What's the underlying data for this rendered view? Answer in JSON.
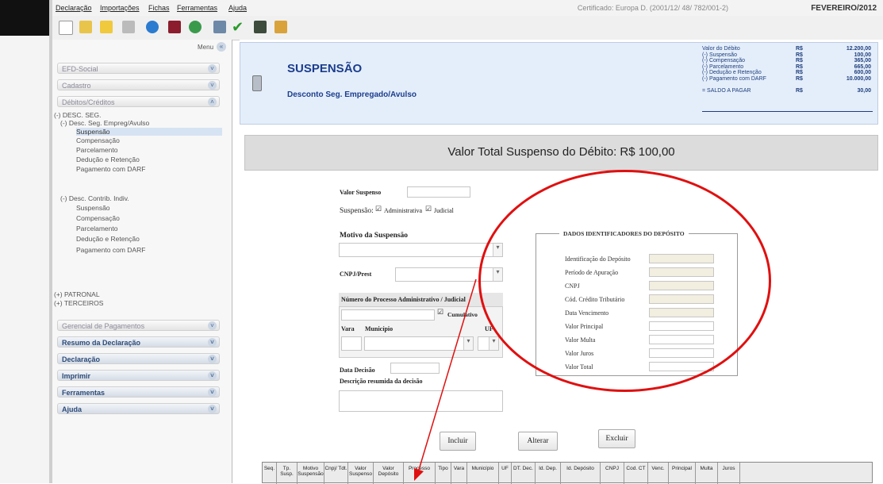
{
  "menu": [
    "Declaração",
    "Importações",
    "Fichas",
    "Ferramentas",
    "Ajuda"
  ],
  "toolbar": {
    "icons": [
      "new-file-icon",
      "open-folder-icon",
      "folder-icon",
      "trash-icon",
      "globe-icon",
      "save-icon",
      "cd-icon",
      "print-icon",
      "check-icon",
      "document-icon",
      "book-icon"
    ],
    "certificate": "Certificado: Europa D. (2001/12/ 48/ 782/001-2)",
    "period": "FEVEREIRO/2012"
  },
  "sidebar": {
    "menu_label": "Menu",
    "sections_top": [
      "EFD-Social",
      "Cadastro",
      "Débitos/Créditos"
    ],
    "tree": {
      "root": "(-) DESC. SEG.",
      "group1": "(-) Desc. Seg. Empreg/Avulso",
      "group1_items": [
        "Suspensão",
        "Compensação",
        "Parcelamento",
        "Dedução e Retenção",
        "Pagamento com DARF"
      ],
      "group1_selected": "Suspensão",
      "group2": "(-) Desc. Contrib. Indiv.",
      "group2_items": [
        "Suspensão",
        "Compensação",
        "Parcelamento",
        "Dedução e Retenção",
        "Pagamento com DARF"
      ],
      "extra": [
        "(+) PATRONAL",
        "(+) TERCEIROS"
      ]
    },
    "sections_bottom": [
      "Gerencial de Pagamentos",
      "Resumo da Declaração",
      "Declaração",
      "Imprimir",
      "Ferramentas",
      "Ajuda"
    ]
  },
  "header": {
    "title": "SUSPENSÃO",
    "subtitle": "Desconto Seg. Empregado/Avulso",
    "summary": [
      {
        "label": "Valor do Débito",
        "currency": "R$",
        "value": "12.200,00"
      },
      {
        "label": "(-) Suspensão",
        "currency": "R$",
        "value": "100,00"
      },
      {
        "label": "(-) Compensação",
        "currency": "R$",
        "value": "365,00"
      },
      {
        "label": "(-) Parcelamento",
        "currency": "R$",
        "value": "665,00"
      },
      {
        "label": "(-) Dedução e Retenção",
        "currency": "R$",
        "value": "600,00"
      },
      {
        "label": "(-) Pagamento com DARF",
        "currency": "R$",
        "value": "10.000,00"
      }
    ],
    "balance": {
      "label": "= SALDO A PAGAR",
      "currency": "R$",
      "value": "30,00"
    }
  },
  "total_banner": "Valor Total Suspenso do Débito: R$ 100,00",
  "form": {
    "valor_suspenso_label": "Valor Suspenso",
    "valor_suspenso_value": "",
    "suspensao_label": "Suspensão:",
    "administrativa_label": "Administrativa",
    "administrativa_checked": true,
    "judicial_label": "Judicial",
    "judicial_checked": true,
    "motivo_label": "Motivo da Suspensão",
    "motivo_value": "",
    "cnpj_label": "CNPJ/Prest",
    "cnpj_value": "",
    "processo_label": "Número do Processo Administrativo / Judicial",
    "cumulativo_label": "Cumulativo",
    "cumulativo_checked": true,
    "vara_label": "Vara",
    "municipio_label": "Município",
    "uf_label": "UF",
    "data_decisao_label": "Data Decisão",
    "descricao_label": "Descrição resumida da decisão"
  },
  "deposit": {
    "title": "DADOS IDENTIFICADORES DO DEPÓSITO",
    "fields": [
      "Identificação do Depósito",
      "Período de Apuração",
      "CNPJ",
      "Cód. Crédito Tributário",
      "Data Vencimento",
      "Valor Principal",
      "Valor Multa",
      "Valor Juros",
      "Valor Total"
    ]
  },
  "buttons": {
    "incluir": "Incluir",
    "alterar": "Alterar",
    "excluir": "Excluir"
  },
  "grid_columns": [
    "Seq.",
    "Tp. Susp.",
    "Motivo Suspensão",
    "Cnpj/ Tdt.",
    "Valor Suspenso",
    "Valor Depósito",
    "Processo",
    "Tipo",
    "Vara",
    "Município",
    "UF",
    "DT. Dec.",
    "Id. Dep.",
    "Id. Depósito",
    "CNPJ",
    "Cod. CT",
    "Venc.",
    "Principal",
    "Multa",
    "Juros"
  ],
  "colors": {
    "title": "#1c3d8c",
    "header_bg": "#e4eefb",
    "annotation": "#e01010"
  }
}
